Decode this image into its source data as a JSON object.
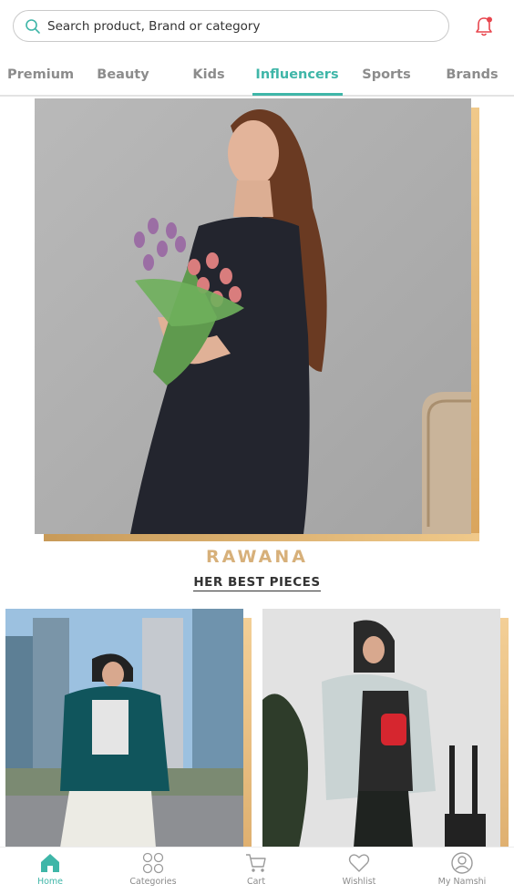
{
  "search": {
    "placeholder": "Search product, Brand or category"
  },
  "tabs": [
    {
      "label": "Premium"
    },
    {
      "label": "Beauty"
    },
    {
      "label": "Kids"
    },
    {
      "label": "Influencers",
      "active": true
    },
    {
      "label": "Sports"
    },
    {
      "label": "Brands"
    }
  ],
  "hero": {
    "image": "influencer-holding-tulips-photo"
  },
  "influencer": {
    "name": "RAWANA",
    "subtitle": "HER BEST PIECES"
  },
  "products": [
    {
      "image": "outfit-green-blazer-city-photo"
    },
    {
      "image": "outfit-grey-jacket-red-bag-photo"
    }
  ],
  "bottom_nav": [
    {
      "label": "Home",
      "icon": "home-icon",
      "active": true
    },
    {
      "label": "Categories",
      "icon": "categories-icon"
    },
    {
      "label": "Cart",
      "icon": "cart-icon"
    },
    {
      "label": "Wishlist",
      "icon": "heart-icon"
    },
    {
      "label": "My Namshi",
      "icon": "user-icon"
    }
  ],
  "colors": {
    "accent": "#3fb6a8",
    "gold": "#d7b07a",
    "notification": "#e8464e"
  }
}
